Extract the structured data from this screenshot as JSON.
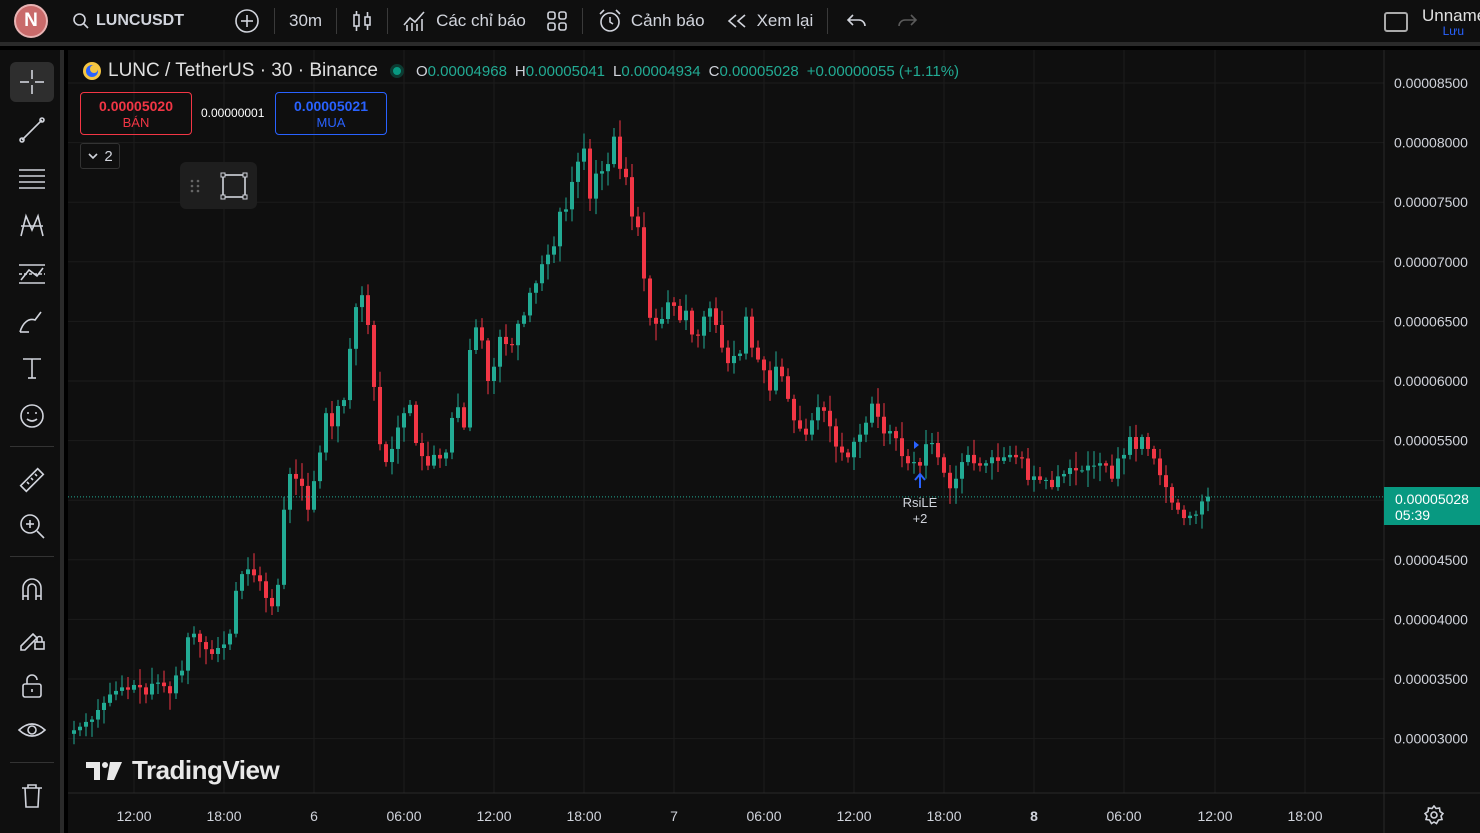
{
  "topbar": {
    "avatar_letter": "N",
    "symbol": "LUNCUSDT",
    "interval": "30m",
    "indicators_label": "Các chỉ báo",
    "alerts_label": "Cảnh báo",
    "replay_label": "Xem lại",
    "layout_name": "Unnamed",
    "layout_save": "Lưu"
  },
  "left_toolbar": {
    "icons": [
      "crosshair-icon",
      "trend-line-icon",
      "fib-icon",
      "pattern-icon",
      "prediction-icon",
      "brush-icon",
      "text-icon",
      "emoji-icon",
      "ruler-icon",
      "zoom-in-icon",
      "magnet-icon",
      "lock-drawing-icon",
      "lock-icon",
      "eye-icon",
      "trash-icon"
    ]
  },
  "legend": {
    "title": "LUNC / TetherUS · 30 · Binance",
    "o_key": "O",
    "o_val": "0.00004968",
    "h_key": "H",
    "h_val": "0.00005041",
    "l_key": "L",
    "l_val": "0.00004934",
    "c_key": "C",
    "c_val": "0.00005028",
    "change": "+0.00000055 (+1.11%)"
  },
  "trade": {
    "sell_price": "0.00005020",
    "sell_label": "BÁN",
    "spread": "0.00000001",
    "buy_price": "0.00005021",
    "buy_label": "MUA",
    "indicators_count": "2"
  },
  "brand": "TradingView",
  "current_price": {
    "value": "0.00005028",
    "countdown": "05:39"
  },
  "marker": {
    "name": "RsiLE",
    "extra": "+2"
  },
  "colors": {
    "up": "#22ab94",
    "down": "#f23645",
    "bg": "#0f0f0f",
    "accent": "#2962ff"
  },
  "chart_data": {
    "type": "candlestick",
    "title": "LUNC / TetherUS · 30 · Binance",
    "y_ticks": [
      "0.00008500",
      "0.00008000",
      "0.00007500",
      "0.00007000",
      "0.00006500",
      "0.00006000",
      "0.00005500",
      "0.00005000",
      "0.00004500",
      "0.00004000",
      "0.00003500",
      "0.00003000"
    ],
    "x_ticks": [
      "12:00",
      "18:00",
      "6",
      "06:00",
      "12:00",
      "18:00",
      "7",
      "06:00",
      "12:00",
      "18:00",
      "8",
      "06:00",
      "12:00",
      "18:00"
    ],
    "x_ticks_bold": [
      false,
      false,
      false,
      false,
      false,
      false,
      false,
      false,
      false,
      false,
      true,
      false,
      false,
      false
    ],
    "ylim": [
      2.82e-05,
      8.73e-05
    ],
    "close": [
      3.07,
      3.1,
      3.14,
      3.16,
      3.24,
      3.3,
      3.37,
      3.4,
      3.43,
      3.41,
      3.45,
      3.43,
      3.37,
      3.46,
      3.47,
      3.44,
      3.38,
      3.53,
      3.57,
      3.85,
      3.88,
      3.81,
      3.75,
      3.71,
      3.76,
      3.79,
      3.88,
      4.24,
      4.38,
      4.42,
      4.37,
      4.32,
      4.18,
      4.11,
      4.29,
      4.92,
      5.22,
      5.18,
      5.12,
      4.92,
      5.16,
      5.4,
      5.73,
      5.62,
      5.79,
      5.84,
      6.27,
      6.62,
      6.72,
      6.47,
      5.95,
      5.47,
      5.32,
      5.43,
      5.61,
      5.73,
      5.8,
      5.48,
      5.37,
      5.29,
      5.38,
      5.35,
      5.4,
      5.69,
      5.78,
      5.61,
      6.26,
      6.45,
      6.34,
      6.0,
      6.12,
      6.37,
      6.31,
      6.3,
      6.48,
      6.55,
      6.74,
      6.82,
      6.98,
      7.06,
      7.13,
      7.42,
      7.44,
      7.67,
      7.84,
      7.95,
      7.53,
      7.74,
      7.76,
      7.82,
      8.05,
      7.78,
      7.71,
      7.38,
      7.29,
      6.86,
      6.53,
      6.48,
      6.52,
      6.66,
      6.63,
      6.51,
      6.59,
      6.39,
      6.38,
      6.54,
      6.61,
      6.47,
      6.28,
      6.15,
      6.21,
      6.23,
      6.54,
      6.28,
      6.18,
      6.09,
      5.92,
      6.12,
      6.04,
      5.85,
      5.67,
      5.6,
      5.55,
      5.67,
      5.78,
      5.75,
      5.62,
      5.45,
      5.4,
      5.36,
      5.49,
      5.55,
      5.65,
      5.81,
      5.7,
      5.56,
      5.58,
      5.52,
      5.37,
      5.31,
      5.32,
      5.29,
      5.47,
      5.48,
      5.36,
      5.23,
      5.1,
      5.18,
      5.32,
      5.38,
      5.31,
      5.29,
      5.31,
      5.36,
      5.33,
      5.36,
      5.38,
      5.36,
      5.35,
      5.17,
      5.2,
      5.17,
      5.17,
      5.11,
      5.2,
      5.22,
      5.27,
      5.25,
      5.25,
      5.29,
      5.29,
      5.31,
      5.29,
      5.18,
      5.35,
      5.38,
      5.53,
      5.43,
      5.53,
      5.43,
      5.35,
      5.21,
      5.11,
      4.98,
      4.92,
      4.85,
      4.87,
      4.88,
      4.99,
      5.03
    ]
  }
}
